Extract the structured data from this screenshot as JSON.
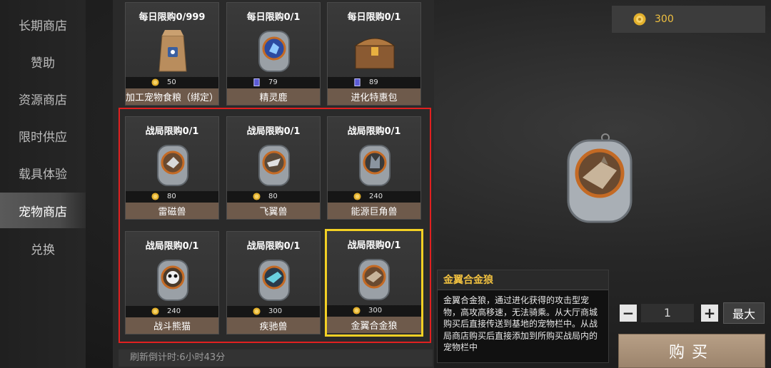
{
  "sidebar": {
    "items": [
      {
        "label": "长期商店"
      },
      {
        "label": "赞助"
      },
      {
        "label": "资源商店"
      },
      {
        "label": "限时供应"
      },
      {
        "label": "载具体验"
      },
      {
        "label": "宠物商店",
        "active": true
      },
      {
        "label": "兑换"
      }
    ]
  },
  "currency": {
    "icon": "gold-coin-icon",
    "value": "300"
  },
  "cards": [
    {
      "limit": "每日限购0/999",
      "price": "50",
      "price_icon": "gold-coin-icon",
      "name": "加工宠物食粮（绑定）",
      "art": "food-bag-icon"
    },
    {
      "limit": "每日限购0/1",
      "price": "79",
      "price_icon": "ticket-card-icon",
      "name": "精灵鹿",
      "art": "dog-tag-deer-icon"
    },
    {
      "limit": "每日限购0/1",
      "price": "89",
      "price_icon": "ticket-card-icon",
      "name": "进化特惠包",
      "art": "treasure-chest-icon"
    },
    {
      "limit": "战局限购0/1",
      "price": "80",
      "price_icon": "gold-coin-icon",
      "name": "雷磁兽",
      "art": "dog-tag-beast-icon"
    },
    {
      "limit": "战局限购0/1",
      "price": "80",
      "price_icon": "gold-coin-icon",
      "name": "飞翼兽",
      "art": "dog-tag-wing-icon"
    },
    {
      "limit": "战局限购0/1",
      "price": "240",
      "price_icon": "gold-coin-icon",
      "name": "能源巨角兽",
      "art": "dog-tag-horn-icon"
    },
    {
      "limit": "战局限购0/1",
      "price": "240",
      "price_icon": "gold-coin-icon",
      "name": "战斗熊猫",
      "art": "dog-tag-panda-icon"
    },
    {
      "limit": "战局限购0/1",
      "price": "300",
      "price_icon": "gold-coin-icon",
      "name": "疾驰兽",
      "art": "dog-tag-wolf-icon"
    },
    {
      "limit": "战局限购0/1",
      "price": "300",
      "price_icon": "gold-coin-icon",
      "name": "金翼合金狼",
      "art": "dog-tag-alloy-wolf-icon",
      "selected": true
    }
  ],
  "refresh_text": "刷新倒计时:6小时43分",
  "detail": {
    "title": "金翼合金狼",
    "description": "金翼合金狼，通过进化获得的攻击型宠物，高攻高移速，无法骑乘。从大厅商城购买后直接传送到基地的宠物栏中。从战局商店购买后直接添加到所购买战局内的宠物栏中"
  },
  "purchase": {
    "quantity": "1",
    "minus_label": "−",
    "plus_label": "+",
    "max_label": "最大",
    "buy_label": "购买"
  },
  "colors": {
    "accent_gold": "#f0c040",
    "selected_border": "#f2d024",
    "highlight_red": "#e02020",
    "name_bar": "#6e5a4b"
  }
}
